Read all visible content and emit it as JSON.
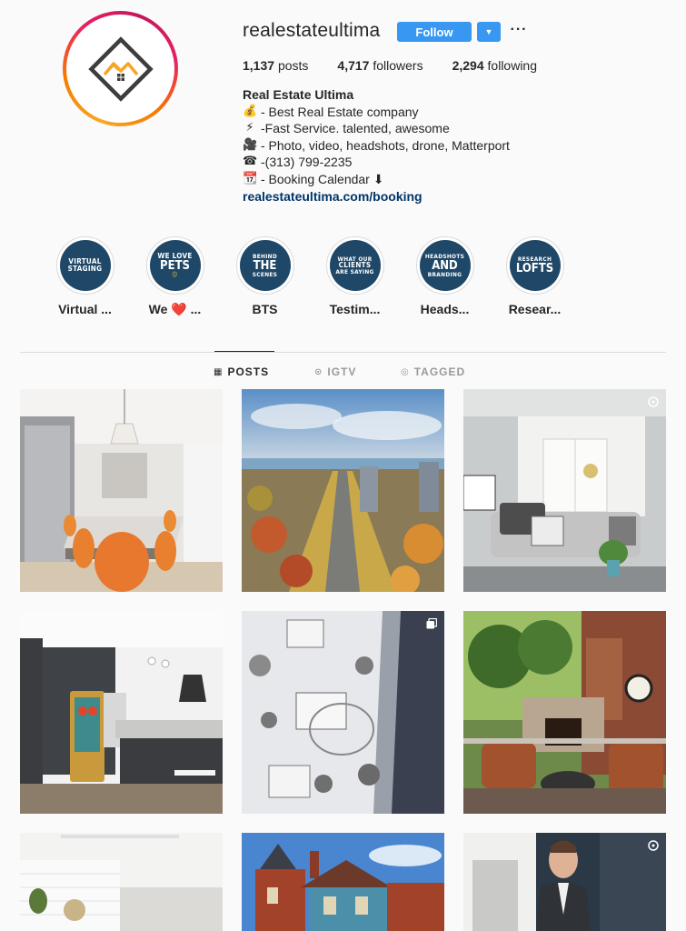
{
  "profile": {
    "username": "realestateultima",
    "follow_label": "Follow",
    "dropdown_icon": "chevron-down-icon",
    "more_label": "···",
    "posts_count": "1,137",
    "posts_label": "posts",
    "followers_count": "4,717",
    "followers_label": "followers",
    "following_count": "2,294",
    "following_label": "following",
    "bio_name": "Real Estate Ultima",
    "bio_lines": [
      {
        "emoji": "💰",
        "text": "- Best Real Estate company"
      },
      {
        "emoji": "⚡",
        "text": " -Fast Service. talented, awesome"
      },
      {
        "emoji": "🎥",
        "text": " - Photo, video, headshots, drone, Matterport"
      },
      {
        "emoji": "☎",
        "text": " -(313) 799-2235"
      },
      {
        "emoji": "📆",
        "text": " - Booking Calendar ⬇"
      }
    ],
    "bio_link": "realestateultima.com/booking"
  },
  "highlights": [
    {
      "label": "Virtual ...",
      "line1": "VIRTUAL",
      "line2": "STAGING"
    },
    {
      "label": "We ❤️ ...",
      "line1": "WE LOVE",
      "line2": "PETS"
    },
    {
      "label": "BTS",
      "line1": "BEHIND",
      "line2": "THE",
      "line3": "SCENES"
    },
    {
      "label": "Testim...",
      "line1": "WHAT OUR",
      "line2": "CLIENTS",
      "line3": "ARE SAYING"
    },
    {
      "label": "Heads...",
      "line1": "HEADSHOTS",
      "line2": "AND",
      "line3": "BRANDING"
    },
    {
      "label": "Resear...",
      "line1": "RESEARCH",
      "line2": "LOFTS"
    }
  ],
  "tabs": {
    "posts": "POSTS",
    "igtv": "IGTV",
    "tagged": "TAGGED"
  },
  "posts": [
    {
      "name": "modern-kitchen-orange-chairs",
      "multi": false
    },
    {
      "name": "aerial-city-boulevard",
      "multi": false
    },
    {
      "name": "living-room-gray-sofa",
      "multi": true
    },
    {
      "name": "dark-kitchen-tiki-fridge",
      "multi": false
    },
    {
      "name": "snowy-aerial-houses",
      "multi": true
    },
    {
      "name": "patio-stone-fireplace",
      "multi": false
    },
    {
      "name": "white-shiplap-room",
      "multi": false
    },
    {
      "name": "victorian-houses",
      "multi": false
    },
    {
      "name": "man-in-suit-doorway",
      "multi": true
    }
  ],
  "colors": {
    "accent": "#3897f0",
    "highlight_bg": "#1f4868",
    "link": "#003569"
  }
}
